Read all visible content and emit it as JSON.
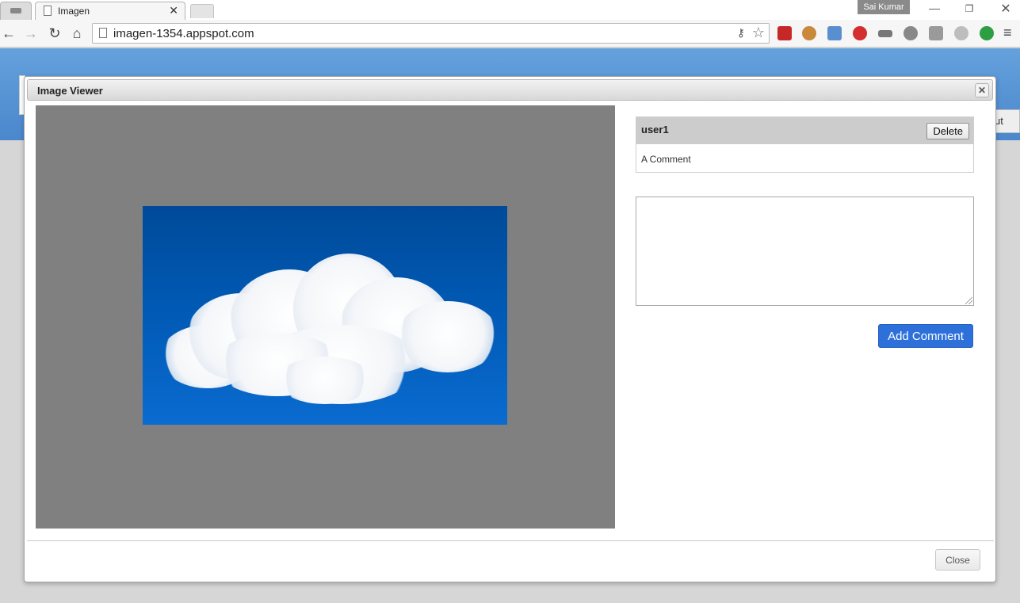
{
  "browser": {
    "tab_title": "Imagen",
    "tab_icon": "document-icon",
    "profile_name": "Sai Kumar",
    "url": "imagen-1354.appspot.com",
    "window_controls": {
      "minimize": "—",
      "restore": "❐",
      "close": "✕"
    },
    "nav": {
      "back": "←",
      "forward": "→",
      "reload": "↻",
      "home": "⌂"
    },
    "extensions": [
      "bookmark-icon",
      "cookie-icon",
      "image-icon",
      "adblock-icon",
      "incognito-icon",
      "search-icon",
      "rss-icon",
      "sync-icon",
      "evernote-icon"
    ],
    "extension_colors": [
      "#c62828",
      "#c9893a",
      "#5a8fcf",
      "#d32f2f",
      "#777777",
      "#888888",
      "#9a9a9a",
      "#bdbdbd",
      "#2e9e44"
    ]
  },
  "page": {
    "partial_button_label": "ut"
  },
  "dialog": {
    "title": "Image Viewer",
    "close_glyph": "✕",
    "comments": [
      {
        "user": "user1",
        "delete_label": "Delete",
        "text": "A Comment"
      }
    ],
    "comment_placeholder": "",
    "add_comment_label": "Add Comment",
    "close_label": "Close"
  },
  "colors": {
    "banner": "#5a96d6",
    "viewer_bg": "#808080",
    "sky": "#0059b3",
    "add_button": "#2d70d9"
  }
}
